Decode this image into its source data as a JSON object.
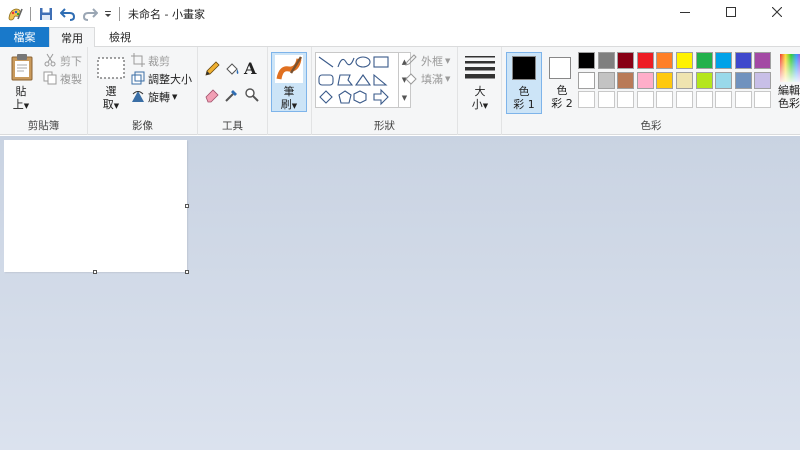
{
  "window": {
    "title": "未命名 - 小畫家",
    "controls": [
      "minimize-icon",
      "maximize-icon",
      "close-icon"
    ]
  },
  "quick_access": [
    "paint-app-icon",
    "save-icon",
    "undo-icon",
    "redo-icon",
    "customize-dropdown-icon"
  ],
  "tabs": [
    {
      "label": "檔案",
      "active": false
    },
    {
      "label": "常用",
      "active": true
    },
    {
      "label": "檢視",
      "active": false
    }
  ],
  "ribbon": {
    "clipboard": {
      "label": "剪貼簿",
      "paste": {
        "line1": "貼",
        "line2": "上"
      },
      "cut": "剪下",
      "copy": "複製"
    },
    "image": {
      "label": "影像",
      "select": {
        "line1": "選",
        "line2": "取"
      },
      "crop": "裁剪",
      "resize": "調整大小",
      "rotate": "旋轉"
    },
    "tools": {
      "label": "工具",
      "items": [
        "pencil-icon",
        "fill-bucket-icon",
        "text-icon",
        "eraser-icon",
        "color-picker-icon",
        "magnifier-icon"
      ]
    },
    "brushes": {
      "line1": "筆",
      "line2": "刷"
    },
    "shapes": {
      "label": "形狀",
      "outline": "外框",
      "fill": "填滿"
    },
    "size": {
      "line1": "大",
      "line2": "小"
    },
    "colors": {
      "label": "色彩",
      "color1": {
        "line1": "色",
        "line2": "彩 1",
        "value": "#000000"
      },
      "color2": {
        "line1": "色",
        "line2": "彩 2",
        "value": "#ffffff"
      },
      "edit": {
        "line1": "編輯",
        "line2": "色彩"
      },
      "palette_row1": [
        "#000000",
        "#7f7f7f",
        "#880015",
        "#ed1c24",
        "#ff7f27",
        "#fff200",
        "#22b14c",
        "#00a2e8",
        "#3f48cc",
        "#a349a4"
      ],
      "palette_row2": [
        "#ffffff",
        "#c3c3c3",
        "#b97a57",
        "#ffaec9",
        "#ffc90e",
        "#efe4b0",
        "#b5e61d",
        "#99d9ea",
        "#7092be",
        "#c8bfe7"
      ]
    }
  },
  "colors_ui": {
    "accent": "#1979ca",
    "ribbon_bg": "#f5f6f7",
    "workspace_bg": "#c9d3e2",
    "active_tool": "#cce4f7"
  }
}
